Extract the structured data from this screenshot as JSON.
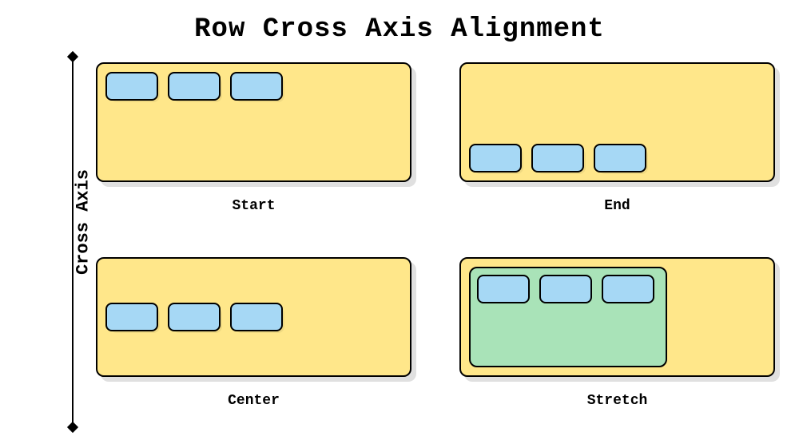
{
  "title": "Row Cross Axis Alignment",
  "axis_label": "Cross Axis",
  "panels": {
    "start": {
      "label": "Start"
    },
    "end": {
      "label": "End"
    },
    "center": {
      "label": "Center"
    },
    "stretch": {
      "label": "Stretch"
    }
  },
  "colors": {
    "container": "#ffe78a",
    "stretch_inner": "#a9e3b8",
    "chip": "#a6d8f5"
  }
}
